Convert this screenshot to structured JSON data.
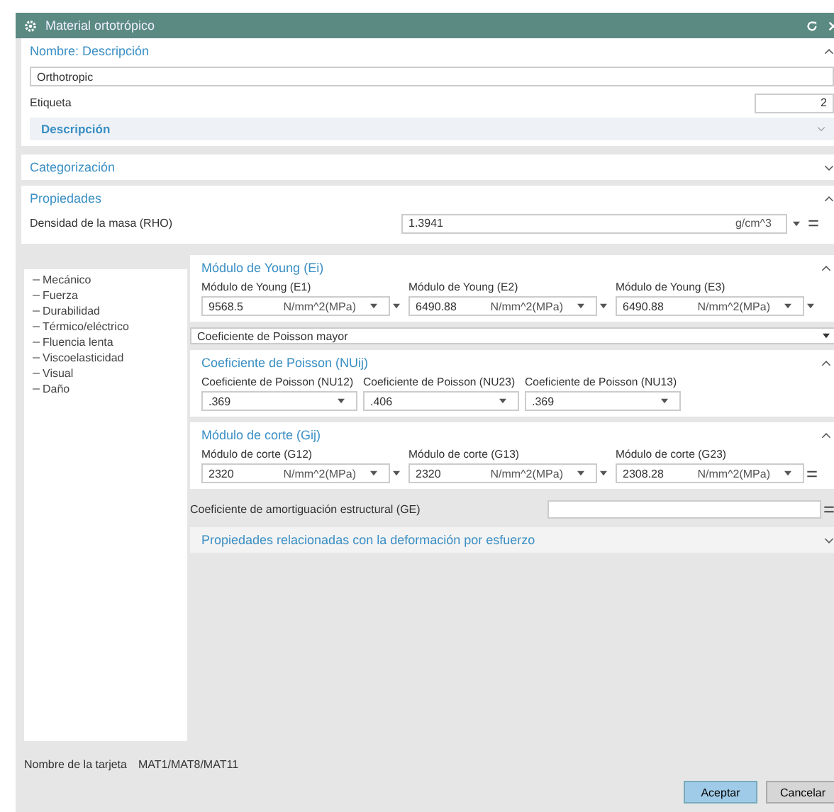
{
  "window": {
    "title": "Material ortotrópico"
  },
  "name_section": {
    "title": "Nombre: Descripción",
    "expanded": true,
    "name_value": "Orthotropic",
    "label": "Etiqueta",
    "label_value": "2",
    "description": {
      "title": "Descripción",
      "expanded": false
    }
  },
  "categorization": {
    "title": "Categorización",
    "expanded": false
  },
  "properties": {
    "title": "Propiedades",
    "expanded": true,
    "density": {
      "label": "Densidad de la masa (RHO)",
      "value": "1.3941",
      "unit": "g/cm^3"
    }
  },
  "tree": [
    {
      "label": "Mecánico"
    },
    {
      "label": "Fuerza"
    },
    {
      "label": "Durabilidad"
    },
    {
      "label": "Térmico/eléctrico"
    },
    {
      "label": "Fluencia lenta"
    },
    {
      "label": "Viscoelasticidad"
    },
    {
      "label": "Visual"
    },
    {
      "label": "Daño"
    }
  ],
  "groups": [
    {
      "kind": "group",
      "title": "Módulo de Young (Ei)",
      "expanded": true,
      "fields": [
        {
          "label": "Módulo de Young (E1)",
          "value": "9568.5",
          "unit": "N/mm^2(MPa)",
          "kind": "menu"
        },
        {
          "label": "Módulo de Young (E2)",
          "value": "6490.88",
          "unit": "N/mm^2(MPa)",
          "kind": "menu"
        },
        {
          "label": "Módulo de Young (E3)",
          "value": "6490.88",
          "unit": "N/mm^2(MPa)",
          "kind": "menu"
        }
      ]
    },
    {
      "kind": "dropdown",
      "value": "Coeficiente de Poisson mayor"
    },
    {
      "kind": "group",
      "title": "Coeficiente de Poisson (NUij)",
      "expanded": true,
      "fields": [
        {
          "label": "Coeficiente de Poisson (NU12)",
          "value": ".369"
        },
        {
          "label": "Coeficiente de Poisson (NU23)",
          "value": ".406"
        },
        {
          "label": "Coeficiente de Poisson (NU13)",
          "value": ".369"
        }
      ]
    },
    {
      "kind": "group",
      "title": "Módulo de corte (Gij)",
      "expanded": true,
      "fields": [
        {
          "label": "Módulo de corte (G12)",
          "value": "2320",
          "unit": "N/mm^2(MPa)",
          "kind": "menu"
        },
        {
          "label": "Módulo de corte (G13)",
          "value": "2320",
          "unit": "N/mm^2(MPa)",
          "kind": "menu"
        },
        {
          "label": "Módulo de corte (G23)",
          "value": "2308.28",
          "unit": "N/mm^2(MPa)",
          "kind": "equals"
        }
      ]
    }
  ],
  "damping": {
    "label": "Coeficiente de amortiguación estructural (GE)"
  },
  "stress": {
    "title": "Propiedades relacionadas con la deformación por esfuerzo",
    "expanded": false
  },
  "card_name": {
    "label": "Nombre de la tarjeta",
    "value": "MAT1/MAT8/MAT11"
  },
  "buttons": [
    {
      "label": "Aceptar",
      "kind": "primary"
    },
    {
      "label": "Cancelar",
      "kind": "secondary"
    }
  ]
}
